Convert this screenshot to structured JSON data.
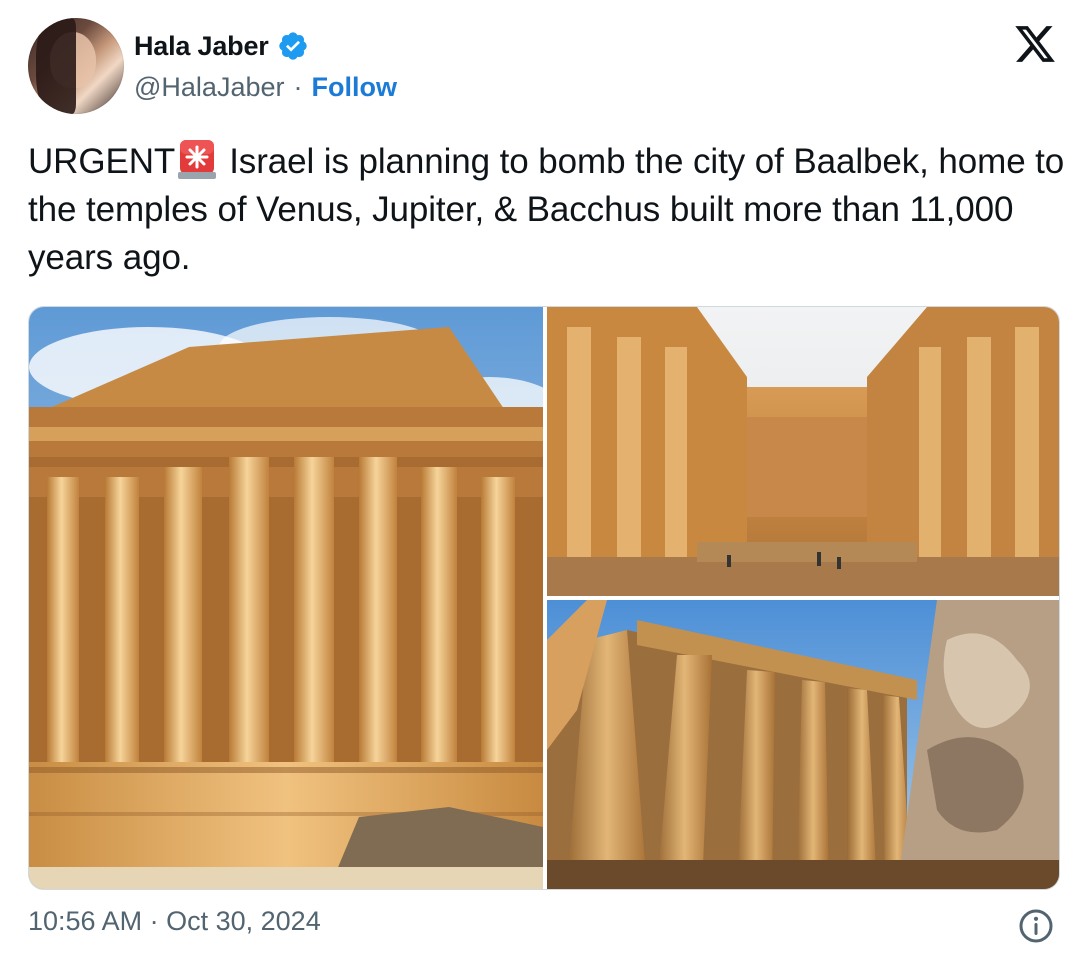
{
  "author": {
    "name": "Hala Jaber",
    "handle": "@HalaJaber",
    "separator": "·",
    "follow_label": "Follow",
    "verified": true,
    "verified_color": "#1d9bf0"
  },
  "tweet": {
    "prefix": "URGENT",
    "emoji": "siren-icon",
    "body": "Israel is planning to bomb the city of Baalbek, home to the temples of Venus, Jupiter, & Bacchus built more than 11,000 years ago."
  },
  "media": {
    "images": [
      {
        "subject": "temple-exterior-colonnade"
      },
      {
        "subject": "temple-interior-cella"
      },
      {
        "subject": "columns-low-angle"
      }
    ]
  },
  "footer": {
    "time": "10:56 AM",
    "separator": "·",
    "date": "Oct 30, 2024"
  },
  "icons": {
    "brand": "x-logo-icon",
    "info": "info-icon"
  },
  "colors": {
    "text": "#0f1419",
    "secondary": "#536471",
    "link": "#1d7bd8",
    "border": "#cfd9de"
  }
}
